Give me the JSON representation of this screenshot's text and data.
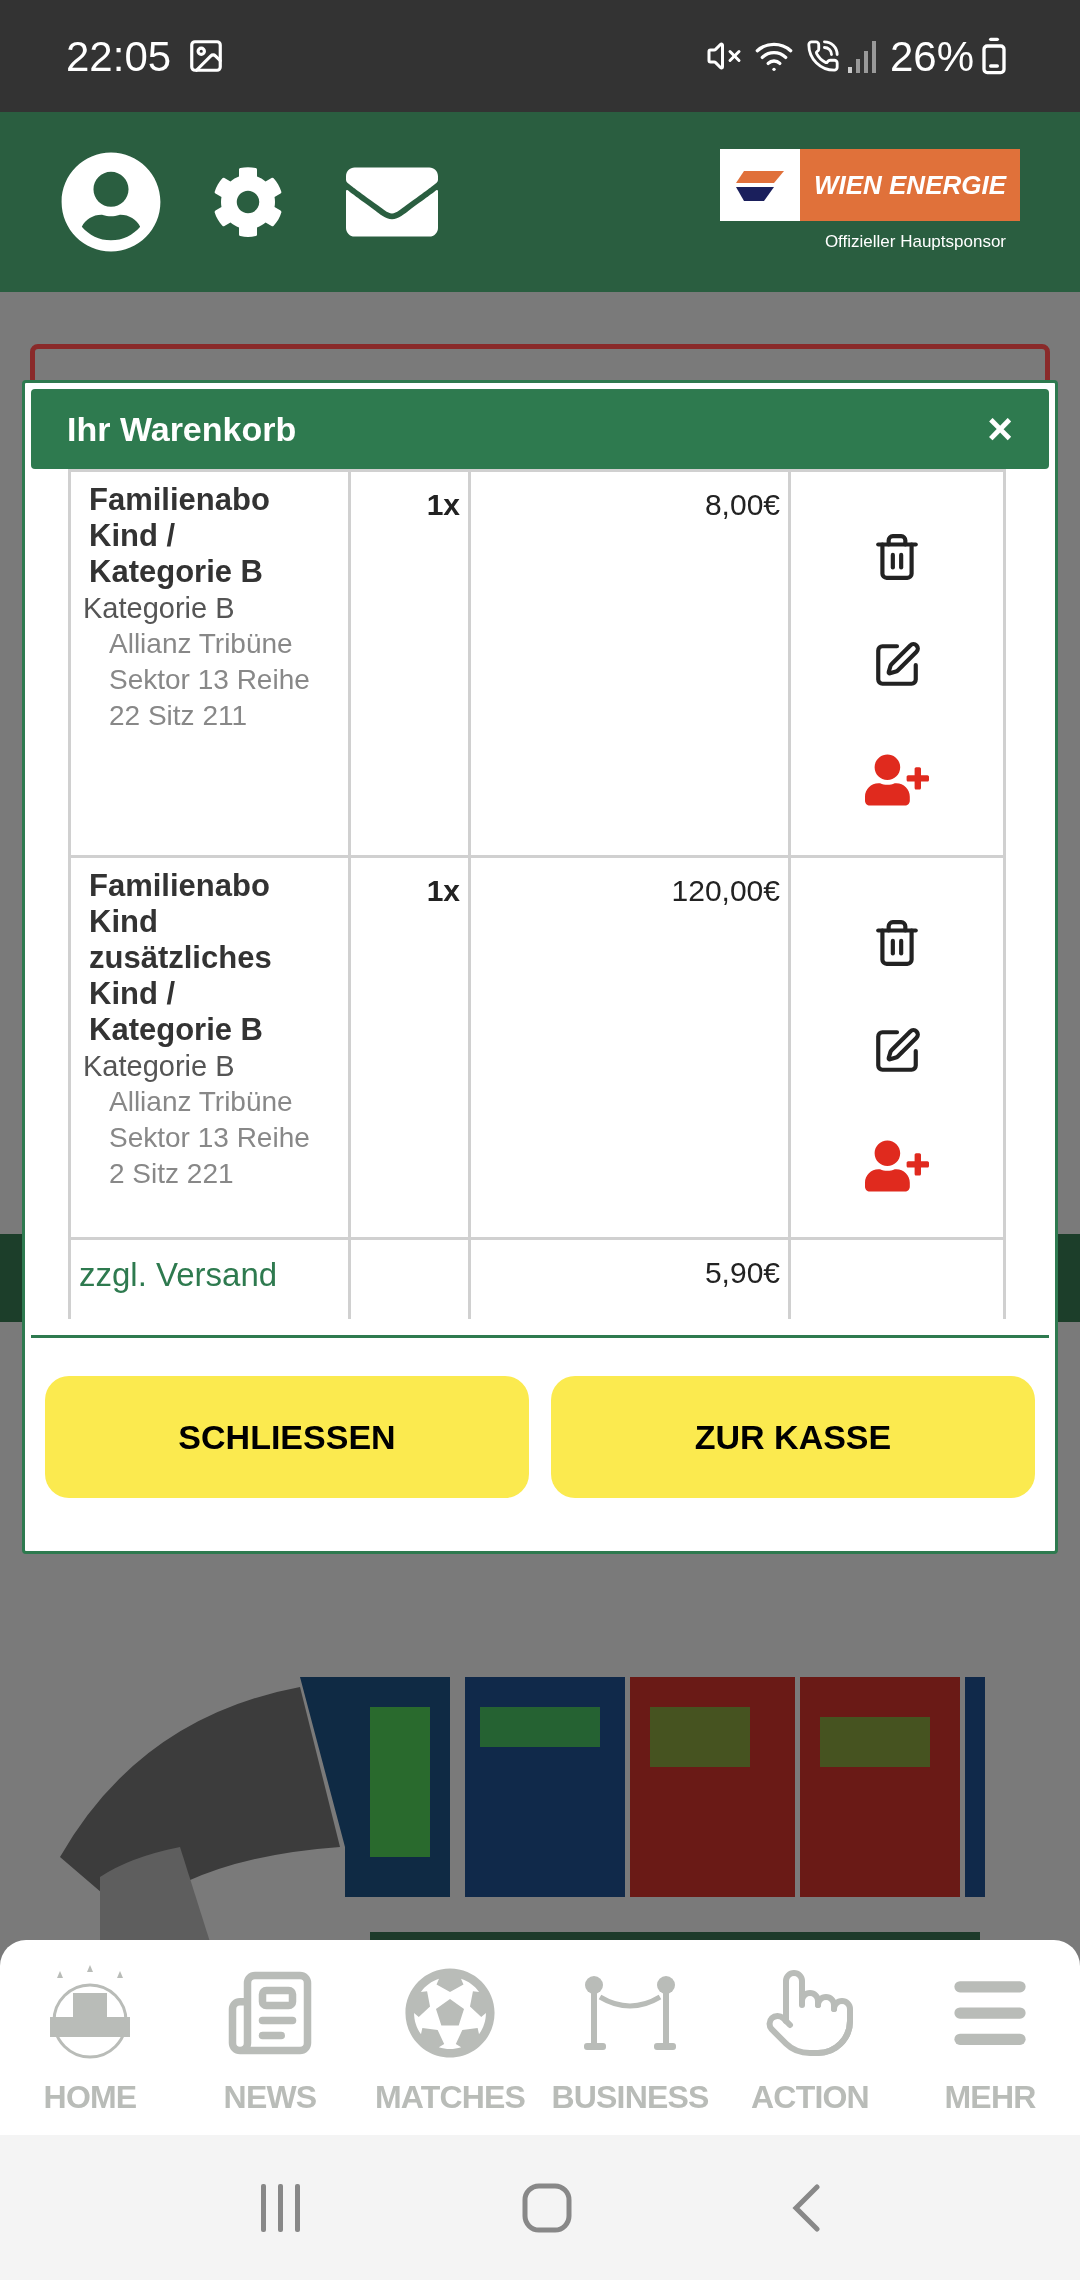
{
  "status_bar": {
    "time": "22:05",
    "battery": "26%"
  },
  "header": {
    "sponsor": {
      "name": "WIEN ENERGIE",
      "caption": "Offizieller Hauptsponsor"
    }
  },
  "cart": {
    "title": "Ihr Warenkorb",
    "close": "×",
    "items": [
      {
        "name": "Familienabo Kind / Kategorie B",
        "category": "Kategorie B",
        "seat": "Allianz Tribüne Sektor 13 Reihe 22 Sitz 211",
        "quantity": "1x",
        "price": "8,00€"
      },
      {
        "name": "Familienabo Kind zusätzliches Kind / Kategorie B",
        "category": "Kategorie B",
        "seat": "Allianz Tribüne Sektor 13 Reihe 2 Sitz 221",
        "quantity": "1x",
        "price": "120,00€"
      }
    ],
    "shipping": {
      "label": "zzgl. Versand",
      "price": "5,90€"
    },
    "buttons": [
      "SCHLIESSEN",
      "ZUR KASSE"
    ]
  },
  "bottom_nav": [
    {
      "label": "HOME",
      "kind": "logo"
    },
    {
      "label": "NEWS",
      "kind": "news"
    },
    {
      "label": "MATCHES",
      "kind": "ball"
    },
    {
      "label": "BUSINESS",
      "kind": "rope"
    },
    {
      "label": "ACTION",
      "kind": "hand"
    },
    {
      "label": "MEHR",
      "kind": "menu"
    }
  ]
}
